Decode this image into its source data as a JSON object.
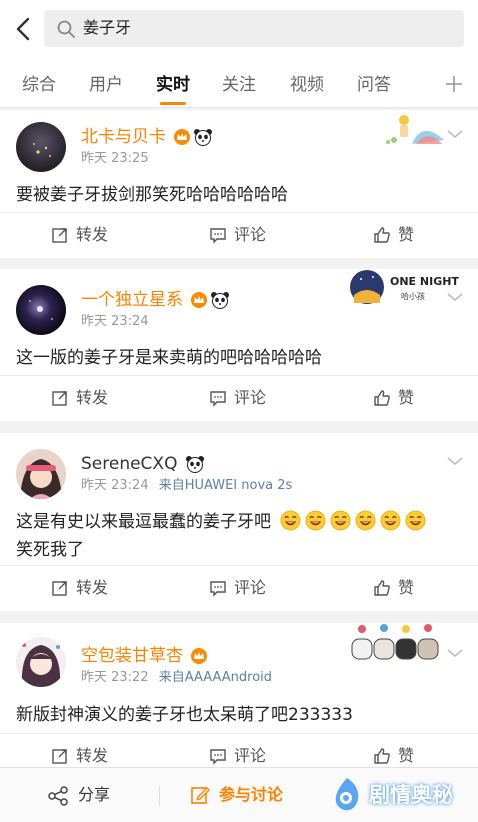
{
  "search": {
    "query": "姜子牙"
  },
  "tabs": [
    {
      "label": "综合"
    },
    {
      "label": "用户"
    },
    {
      "label": "实时"
    },
    {
      "label": "关注"
    },
    {
      "label": "视频"
    },
    {
      "label": "问答"
    }
  ],
  "active_tab": "实时",
  "accent_color": "#ff8200",
  "posts": [
    {
      "username": "北卡与贝卡",
      "time": "昨天 23:25",
      "source": "",
      "text": "要被姜子牙拔剑那笑死哈哈哈哈哈哈",
      "badges": [
        "vip-crown-icon",
        "panda-icon"
      ]
    },
    {
      "username": "一个独立星系",
      "time": "昨天 23:24",
      "source": "",
      "text": "这一版的姜子牙是来卖萌的吧哈哈哈哈哈",
      "badges": [
        "vip-crown-icon",
        "panda-icon"
      ],
      "sticker_title": "ONE NIGHT",
      "sticker_sub": "哈小孩"
    },
    {
      "username": "SereneCXQ",
      "time": "昨天 23:24",
      "source": "来自HUAWEI nova 2s",
      "text_line1": "这是有史以来最逗最蠢的姜子牙吧",
      "text_line2": "笑死我了",
      "badges": [
        "panda-icon"
      ],
      "emoji_count": 6
    },
    {
      "username": "空包装甘草杏",
      "time": "昨天 23:22",
      "source": "来自AAAAAndroid",
      "text": "新版封神演义的姜子牙也太呆萌了吧233333",
      "badges": [
        "vip-crown-icon"
      ]
    }
  ],
  "actions": {
    "repost": "转发",
    "comment": "评论",
    "like": "赞"
  },
  "bottom_bar": {
    "share": "分享",
    "discuss": "参与讨论"
  },
  "watermark": {
    "text": "剧情奥秘"
  }
}
